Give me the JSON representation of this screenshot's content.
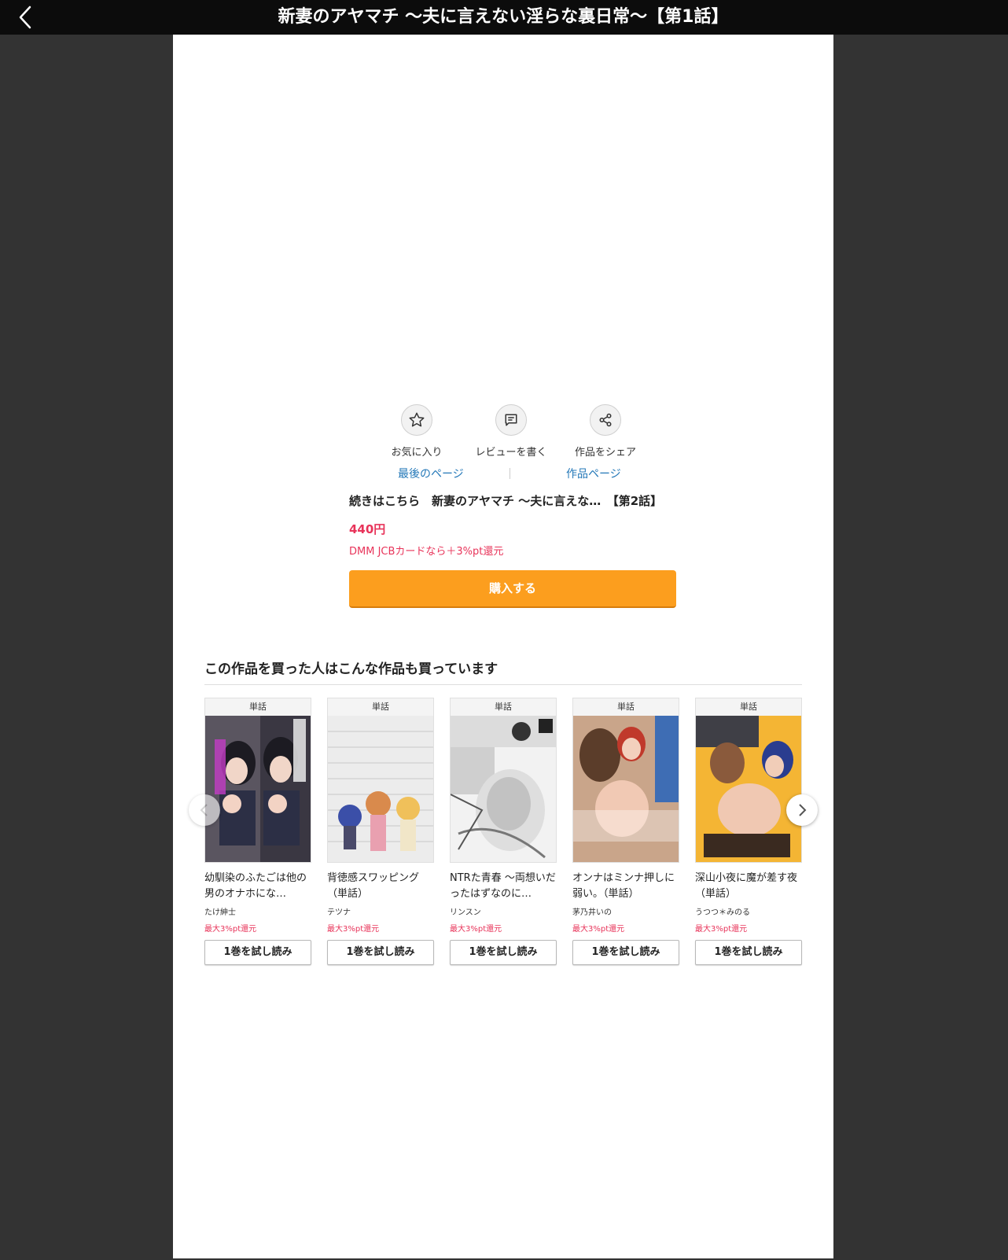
{
  "header": {
    "title": "新妻のアヤマチ 〜夫に言えない淫らな裏日常〜【第1話】"
  },
  "actions": [
    {
      "label": "お気に入り",
      "icon": "star-icon"
    },
    {
      "label": "レビューを書く",
      "icon": "comment-icon"
    },
    {
      "label": "作品をシェア",
      "icon": "share-icon"
    }
  ],
  "links": {
    "last_page": "最後のページ",
    "work_page": "作品ページ"
  },
  "next": {
    "title": "続きはこちら　新妻のアヤマチ 〜夫に言えな…　【第2話】",
    "price": "440円",
    "campaign": "DMM JCBカードなら＋3%pt還元",
    "buy_label": "購入する"
  },
  "recommend": {
    "heading": "この作品を買った人はこんな作品も買っています",
    "items": [
      {
        "badge": "単話",
        "name": "幼馴染のふたごは他の男のオナホにな…",
        "author": "たけ紳士",
        "pt": "最大3%pt還元",
        "trial": "1巻を試し読み"
      },
      {
        "badge": "単話",
        "name": "背徳感スワッピング（単話）",
        "author": "テツナ",
        "pt": "最大3%pt還元",
        "trial": "1巻を試し読み"
      },
      {
        "badge": "単話",
        "name": "NTRた青春 〜両想いだったはずなのに…",
        "author": "リンスン",
        "pt": "最大3%pt還元",
        "trial": "1巻を試し読み"
      },
      {
        "badge": "単話",
        "name": "オンナはミンナ押しに弱い。（単話）",
        "author": "茅乃井いの",
        "pt": "最大3%pt還元",
        "trial": "1巻を試し読み"
      },
      {
        "badge": "単話",
        "name": "深山小夜に魔が差す夜（単話）",
        "author": "うつつ＊みのる",
        "pt": "最大3%pt還元",
        "trial": "1巻を試し読み"
      }
    ]
  },
  "colors": {
    "accent_orange": "#fc9e1e",
    "price_red": "#e8345a",
    "link_blue": "#2478b8",
    "background_dark": "#333333"
  }
}
